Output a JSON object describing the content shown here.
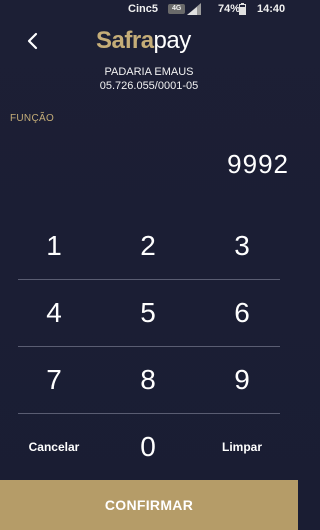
{
  "status_bar": {
    "carrier": "Cinc5",
    "network": "4G",
    "battery": "74%",
    "time": "14:40"
  },
  "header": {
    "logo_bold": "Safra",
    "logo_light": "pay"
  },
  "merchant": {
    "name": "PADARIA EMAUS",
    "document": "05.726.055/0001-05"
  },
  "field": {
    "label": "FUNÇÃO",
    "value": "9992"
  },
  "keypad": {
    "rows": [
      [
        "1",
        "2",
        "3"
      ],
      [
        "4",
        "5",
        "6"
      ],
      [
        "7",
        "8",
        "9"
      ]
    ],
    "cancel": "Cancelar",
    "zero": "0",
    "clear": "Limpar"
  },
  "confirm_label": "CONFIRMAR",
  "colors": {
    "background": "#1c1f35",
    "accent": "#b59c68",
    "logo_gold": "#c5ad78"
  }
}
